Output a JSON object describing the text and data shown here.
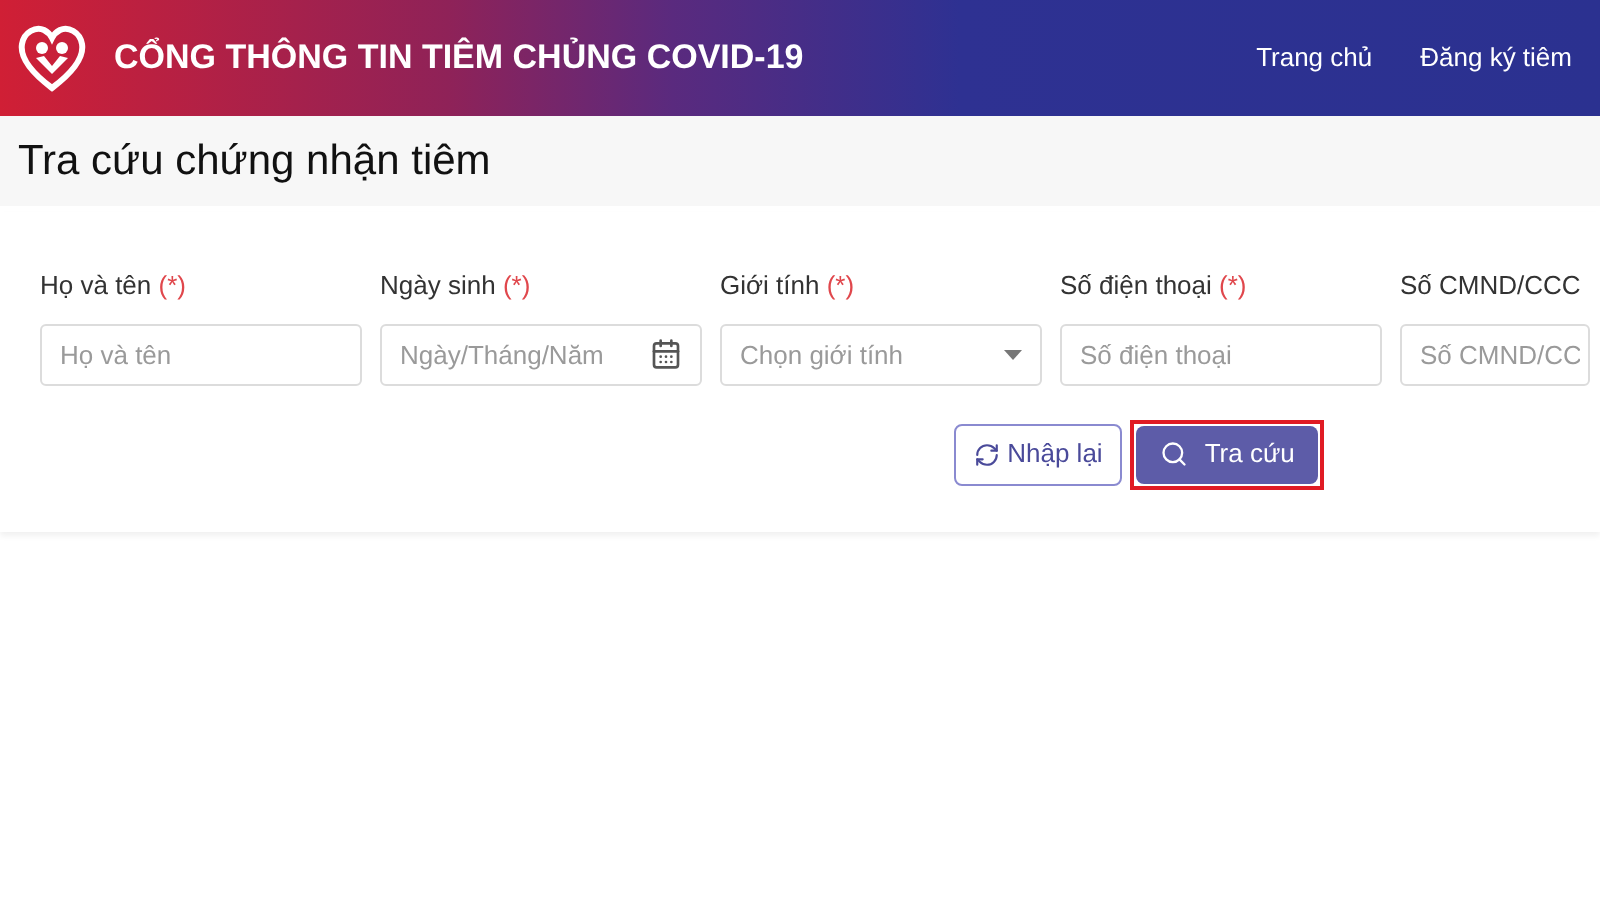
{
  "header": {
    "title": "CỔNG THÔNG TIN TIÊM CHỦNG COVID-19",
    "nav": [
      {
        "label": "Trang chủ"
      },
      {
        "label": "Đăng ký tiêm"
      }
    ]
  },
  "page_title": "Tra cứu chứng nhận tiêm",
  "fields": [
    {
      "kind": "text",
      "label": "Họ và tên",
      "required_mark": "(*)",
      "placeholder": "Họ và tên"
    },
    {
      "kind": "date",
      "label": "Ngày sinh",
      "required_mark": "(*)",
      "placeholder": "Ngày/Tháng/Năm"
    },
    {
      "kind": "select",
      "label": "Giới tính",
      "required_mark": "(*)",
      "placeholder": "Chọn giới tính"
    },
    {
      "kind": "text",
      "label": "Số điện thoại",
      "required_mark": "(*)",
      "placeholder": "Số điện thoại"
    },
    {
      "kind": "text",
      "label": "Số CMND/CCC",
      "placeholder": "Số CMND/CC"
    }
  ],
  "buttons": [
    {
      "kind": "reset",
      "label": "Nhập lại",
      "highlighted": false
    },
    {
      "kind": "search",
      "label": "Tra cứu",
      "highlighted": true
    }
  ]
}
